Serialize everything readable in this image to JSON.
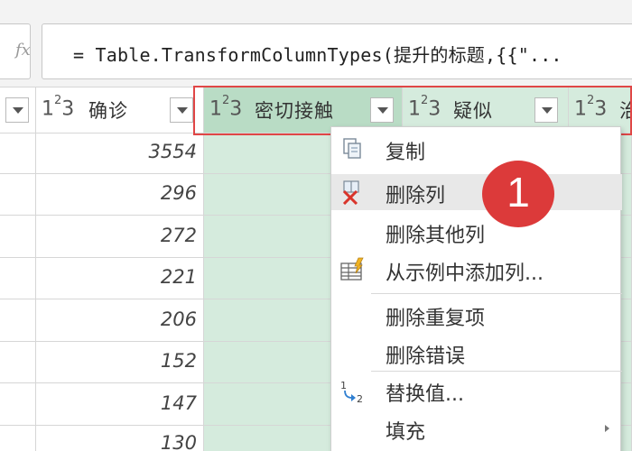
{
  "formula_bar": {
    "fx_label": "fx",
    "formula": "= Table.TransformColumnTypes(提升的标题,{{\"..."
  },
  "columns": [
    {
      "type_icon": "1²3",
      "name": ""
    },
    {
      "type_icon": "1²3",
      "name": "确诊"
    },
    {
      "type_icon": "1²3",
      "name": "密切接触"
    },
    {
      "type_icon": "1²3",
      "name": "疑似"
    },
    {
      "type_icon": "1²3",
      "name": "治"
    }
  ],
  "rows": [
    "3554",
    "296",
    "272",
    "221",
    "206",
    "152",
    "147",
    "130"
  ],
  "context_menu": {
    "items": [
      {
        "label": "复制",
        "icon": "copy-icon"
      },
      {
        "label": "删除列",
        "icon": "delete-column-icon"
      },
      {
        "label": "删除其他列",
        "icon": ""
      },
      {
        "label": "从示例中添加列...",
        "icon": "add-column-from-examples-icon"
      },
      {
        "label": "删除重复项",
        "icon": ""
      },
      {
        "label": "删除错误",
        "icon": ""
      },
      {
        "label": "替换值...",
        "icon": "replace-values-icon"
      },
      {
        "label": "填充",
        "icon": "",
        "submenu": true
      }
    ],
    "replace_icon_text": "1→2"
  },
  "annotation": {
    "step_number": "1"
  },
  "colors": {
    "selected_column": "#d5ebdd",
    "selected_header": "#b9dcc5",
    "highlight_frame": "#e04646",
    "badge": "#dc3a3a"
  }
}
